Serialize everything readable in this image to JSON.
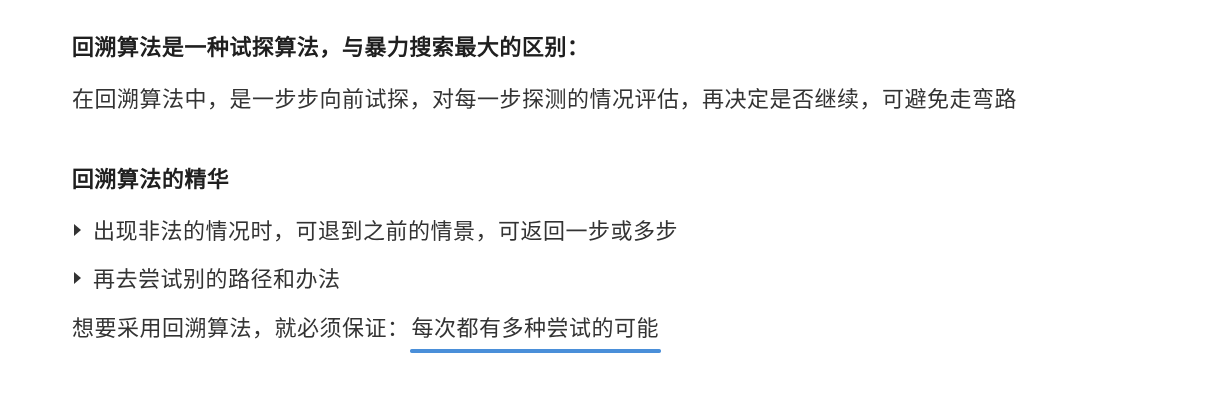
{
  "section1": {
    "title": "回溯算法是一种试探算法，与暴力搜索最大的区别：",
    "body": "在回溯算法中，是一步步向前试探，对每一步探测的情况评估，再决定是否继续，可避免走弯路"
  },
  "section2": {
    "title": "回溯算法的精华",
    "bullets": [
      "出现非法的情况时，可退到之前的情景，可返回一步或多步",
      "再去尝试别的路径和办法"
    ],
    "conclusion_prefix": "想要采用回溯算法，就必须保证：",
    "conclusion_highlight": "每次都有多种尝试的可能"
  },
  "colors": {
    "text": "#333333",
    "heading": "#1f1f1f",
    "underline_accent": "#4a8fd9"
  },
  "icons": {
    "bullet": "triangle-right-icon"
  }
}
